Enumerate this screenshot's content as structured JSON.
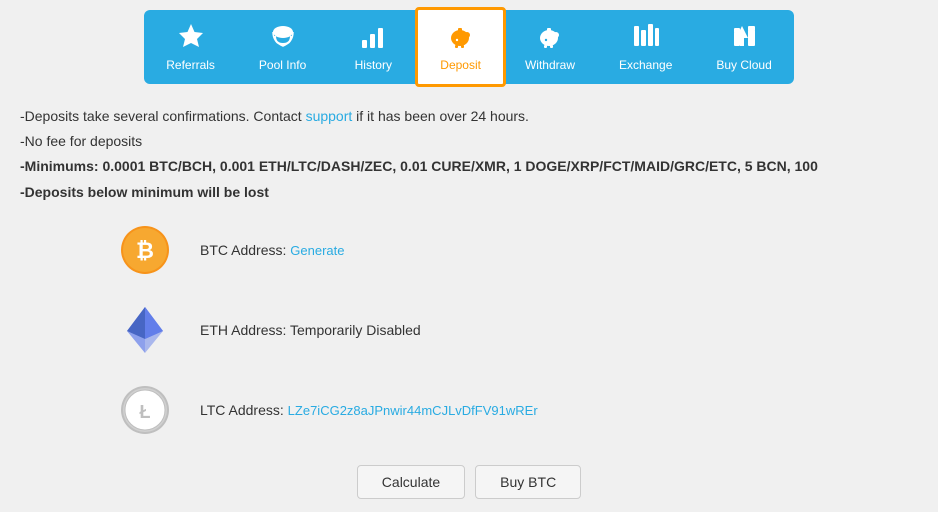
{
  "nav": {
    "items": [
      {
        "id": "referrals",
        "label": "Referrals",
        "icon": "⭐",
        "active": false
      },
      {
        "id": "pool-info",
        "label": "Pool Info",
        "icon": "☁",
        "active": false
      },
      {
        "id": "history",
        "label": "History",
        "icon": "📊",
        "active": false
      },
      {
        "id": "deposit",
        "label": "Deposit",
        "icon": "🐷",
        "active": true
      },
      {
        "id": "withdraw",
        "label": "Withdraw",
        "icon": "🐷",
        "active": false
      },
      {
        "id": "exchange",
        "label": "Exchange",
        "icon": "💹",
        "active": false
      },
      {
        "id": "buy-cloud",
        "label": "Buy Cloud",
        "icon": "💰",
        "active": false
      }
    ]
  },
  "info": {
    "line1_prefix": "-Deposits take several confirmations. Contact ",
    "line1_link": "support",
    "line1_suffix": " if it has been over 24 hours.",
    "line2": "-No fee for deposits",
    "line3": "-Minimums: 0.0001 BTC/BCH, 0.001 ETH/LTC/DASH/ZEC, 0.01 CURE/XMR, 1 DOGE/XRP/FCT/MAID/GRC/ETC, 5 BCN, 100",
    "line4": "-Deposits below minimum will be lost"
  },
  "coins": [
    {
      "id": "btc",
      "label": "BTC Address: ",
      "value": "Generate",
      "value_is_link": true,
      "has_icon": "btc"
    },
    {
      "id": "eth",
      "label": "ETH Address: ",
      "value": "Temporarily Disabled",
      "value_is_link": false,
      "has_icon": "eth"
    },
    {
      "id": "ltc",
      "label": "LTC Address: ",
      "value": "LZe7iCG2z8aJPnwir44mCJLvDfFV91wREr",
      "value_is_link": true,
      "has_icon": "ltc"
    }
  ],
  "buttons": {
    "calculate": "Calculate",
    "buy_btc": "Buy BTC"
  }
}
